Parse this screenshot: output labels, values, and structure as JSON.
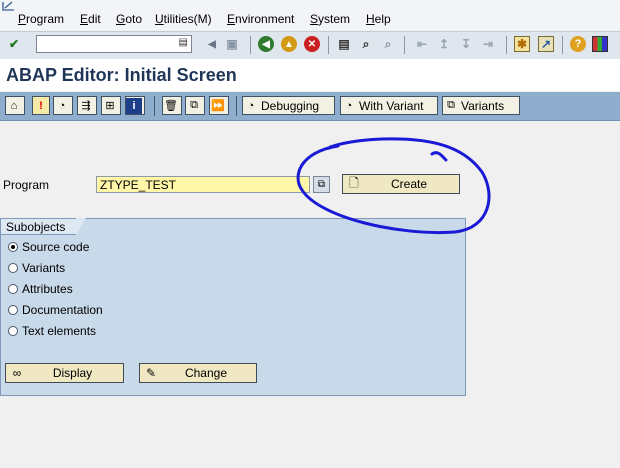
{
  "menu": {
    "items": [
      {
        "label": "Program",
        "ul": "P",
        "rest": "rogram"
      },
      {
        "label": "Edit",
        "ul": "E",
        "rest": "dit"
      },
      {
        "label": "Goto",
        "ul": "G",
        "rest": "oto"
      },
      {
        "label": "Utilities(M)",
        "ul": "U",
        "rest": "tilities(M)"
      },
      {
        "label": "Environment",
        "ul": "E",
        "rest": "nvironment"
      },
      {
        "label": "System",
        "ul": "S",
        "rest": "ystem"
      },
      {
        "label": "Help",
        "ul": "H",
        "rest": "elp"
      }
    ]
  },
  "system_toolbar": {
    "command_field_value": "",
    "icons": [
      "enter-icon",
      "save-icon",
      "back-icon",
      "exit-icon",
      "cancel-icon",
      "print-icon",
      "find-icon",
      "find-next-icon",
      "first-page-icon",
      "previous-page-icon",
      "next-page-icon",
      "last-page-icon",
      "create-session-icon",
      "shortcut-icon",
      "help-icon",
      "layout-icon"
    ]
  },
  "title": "ABAP Editor: Initial Screen",
  "app_toolbar": {
    "debugging_label": "Debugging",
    "with_variant_label": "With Variant",
    "variants_label": "Variants"
  },
  "program": {
    "label": "Program",
    "value": "ZTYPE_TEST"
  },
  "create_label": "Create",
  "subobjects": {
    "title": "Subobjects",
    "options": [
      {
        "label": "Source code",
        "selected": true
      },
      {
        "label": "Variants",
        "selected": false
      },
      {
        "label": "Attributes",
        "selected": false
      },
      {
        "label": "Documentation",
        "selected": false
      },
      {
        "label": "Text elements",
        "selected": false
      }
    ]
  },
  "buttons": {
    "display_label": "Display",
    "change_label": "Change"
  },
  "colors": {
    "title": "#1f3658",
    "app_toolbar": "#8faecd",
    "group_box": "#c8d9ea",
    "input_required": "#fff6a8",
    "annotation": "#1a1ad6"
  }
}
